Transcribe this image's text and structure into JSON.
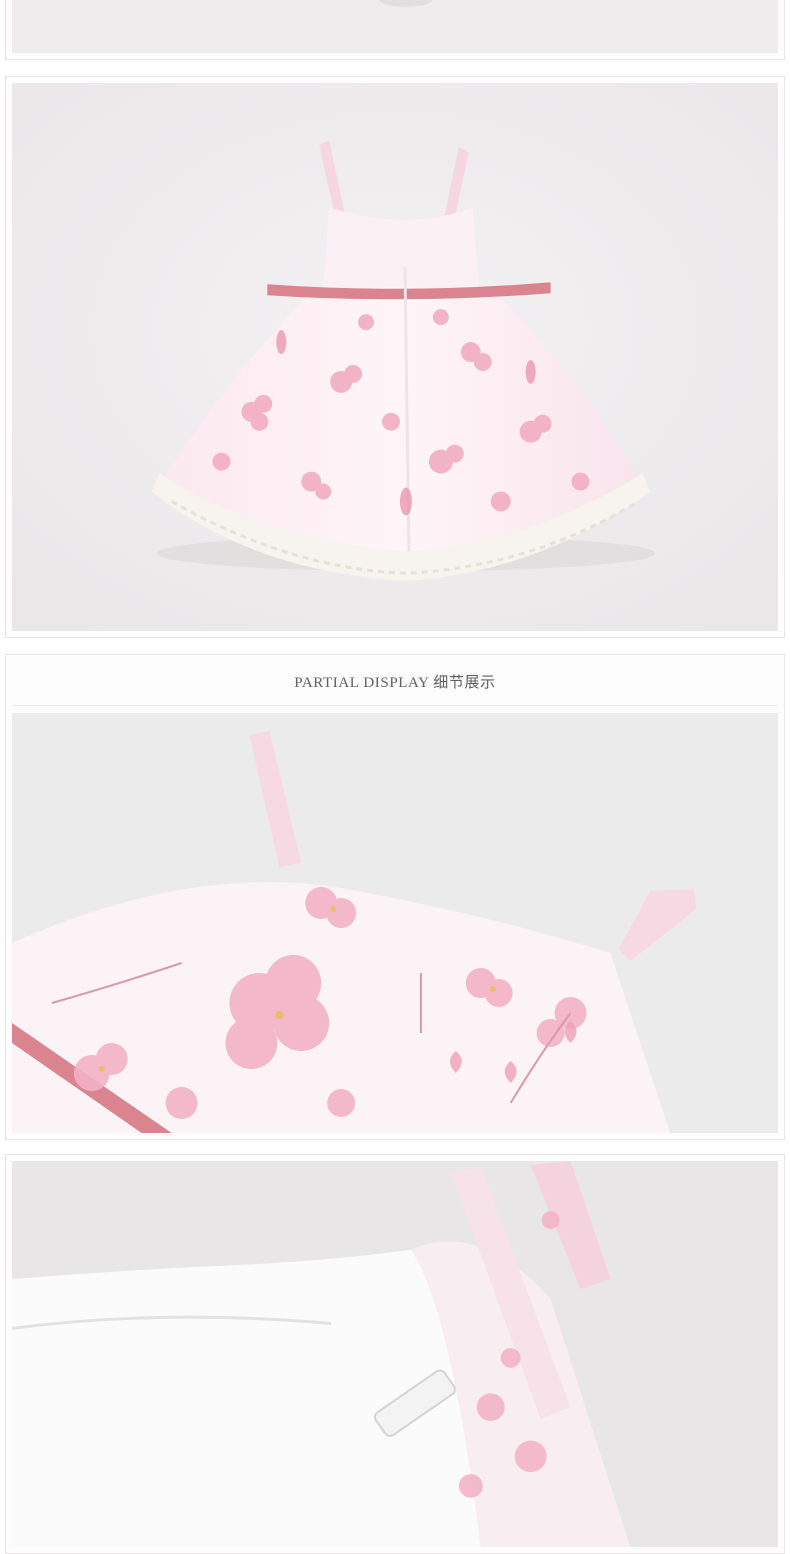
{
  "section_header": {
    "title": "PARTIAL DISPLAY 细节展示"
  },
  "photos": [
    {
      "name": "top-cropped-photo"
    },
    {
      "name": "dress-back-view"
    },
    {
      "name": "detail-bodice-print"
    },
    {
      "name": "detail-strap-lining"
    }
  ],
  "colors": {
    "background": "#efedee",
    "petal": "#f2a9bf",
    "ribbon": "#d9848f",
    "lace": "#f6f3ee"
  }
}
